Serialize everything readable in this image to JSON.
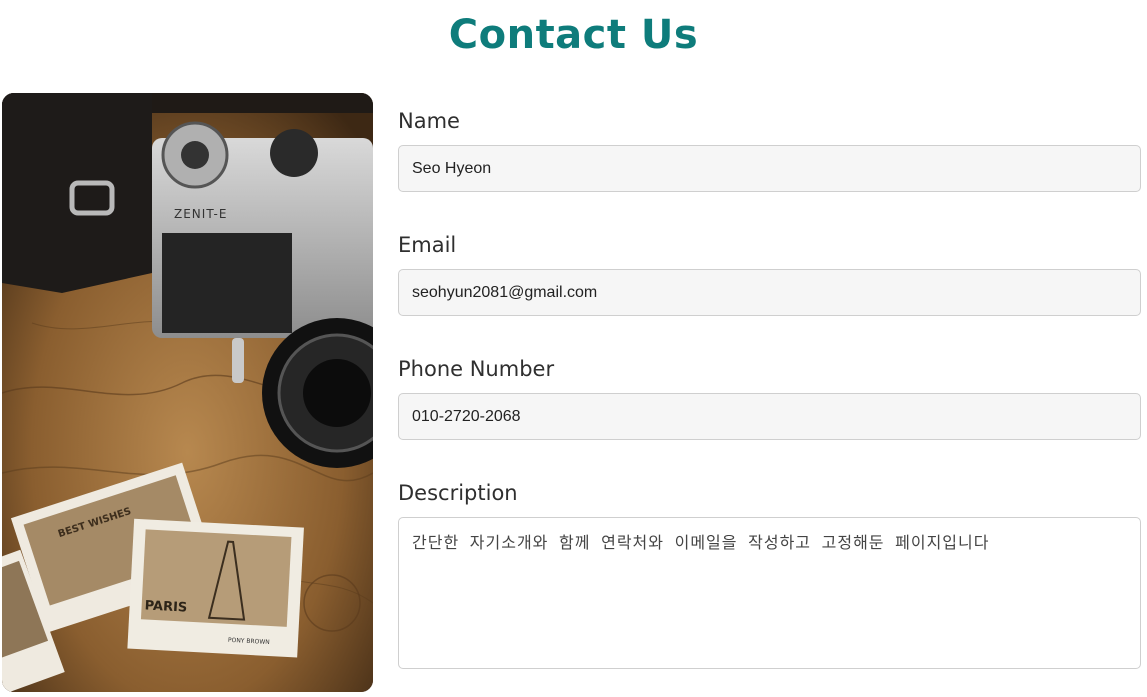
{
  "page": {
    "title": "Contact Us"
  },
  "image": {
    "icon": "camera-travel-photo",
    "camera_brand": "ZENIT-E",
    "postcard_1": "BEST WISHES",
    "postcard_2": "PARIS",
    "postcard_caption": "PONY BROWN"
  },
  "form": {
    "name": {
      "label": "Name",
      "value": "Seo Hyeon"
    },
    "email": {
      "label": "Email",
      "value": "seohyun2081@gmail.com"
    },
    "phone": {
      "label": "Phone Number",
      "value": "010-2720-2068"
    },
    "description": {
      "label": "Description",
      "value": "간단한 자기소개와 함께 연락처와 이메일을 작성하고 고정해둔 페이지입니다"
    }
  }
}
